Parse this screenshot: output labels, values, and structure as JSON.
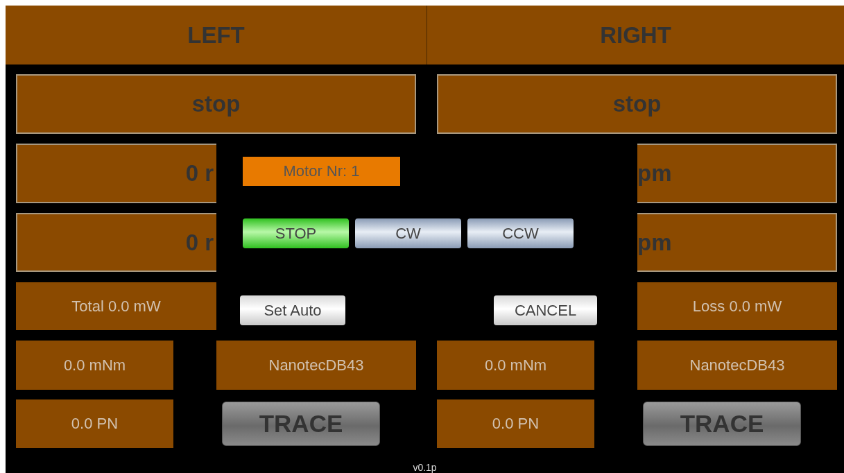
{
  "sides": [
    {
      "header": "LEFT",
      "rows": [
        {
          "cells": [
            {
              "kind": "full",
              "text": "stop"
            }
          ]
        },
        {
          "cells": [
            {
              "kind": "left-cut",
              "text": "0 r"
            }
          ]
        },
        {
          "cells": [
            {
              "kind": "left-cut",
              "text": "0 r"
            }
          ]
        },
        {
          "cells": [
            {
              "kind": "left-cut-small",
              "text": "Total 0.0 mW"
            }
          ]
        },
        {
          "cells": [
            {
              "kind": "small",
              "text": "0.0 mNm"
            },
            {
              "kind": "small",
              "text": "NanotecDB43"
            }
          ]
        },
        {
          "cells": [
            {
              "kind": "small",
              "text": "0.0 PN"
            },
            {
              "kind": "button",
              "text": "TRACE"
            }
          ]
        }
      ]
    },
    {
      "header": "RIGHT",
      "rows": [
        {
          "cells": [
            {
              "kind": "full",
              "text": "stop"
            }
          ]
        },
        {
          "cells": [
            {
              "kind": "hidden",
              "text": ""
            },
            {
              "kind": "right-cut",
              "text": "pm"
            }
          ]
        },
        {
          "cells": [
            {
              "kind": "hidden",
              "text": ""
            },
            {
              "kind": "right-cut",
              "text": "pm"
            }
          ]
        },
        {
          "cells": [
            {
              "kind": "hidden",
              "text": ""
            },
            {
              "kind": "right-cut-small",
              "text": "Loss 0.0 mW"
            }
          ]
        },
        {
          "cells": [
            {
              "kind": "small",
              "text": "0.0 mNm"
            },
            {
              "kind": "small",
              "text": "NanotecDB43"
            }
          ]
        },
        {
          "cells": [
            {
              "kind": "small",
              "text": "0.0 PN"
            },
            {
              "kind": "button",
              "text": "TRACE"
            }
          ]
        }
      ]
    }
  ],
  "dialog": {
    "motor_label": "Motor Nr: 1",
    "directions": [
      {
        "label": "STOP",
        "selected": true
      },
      {
        "label": "CW",
        "selected": false
      },
      {
        "label": "CCW",
        "selected": false
      }
    ],
    "set_auto": "Set Auto",
    "cancel": "CANCEL"
  },
  "version": "v0.1p"
}
